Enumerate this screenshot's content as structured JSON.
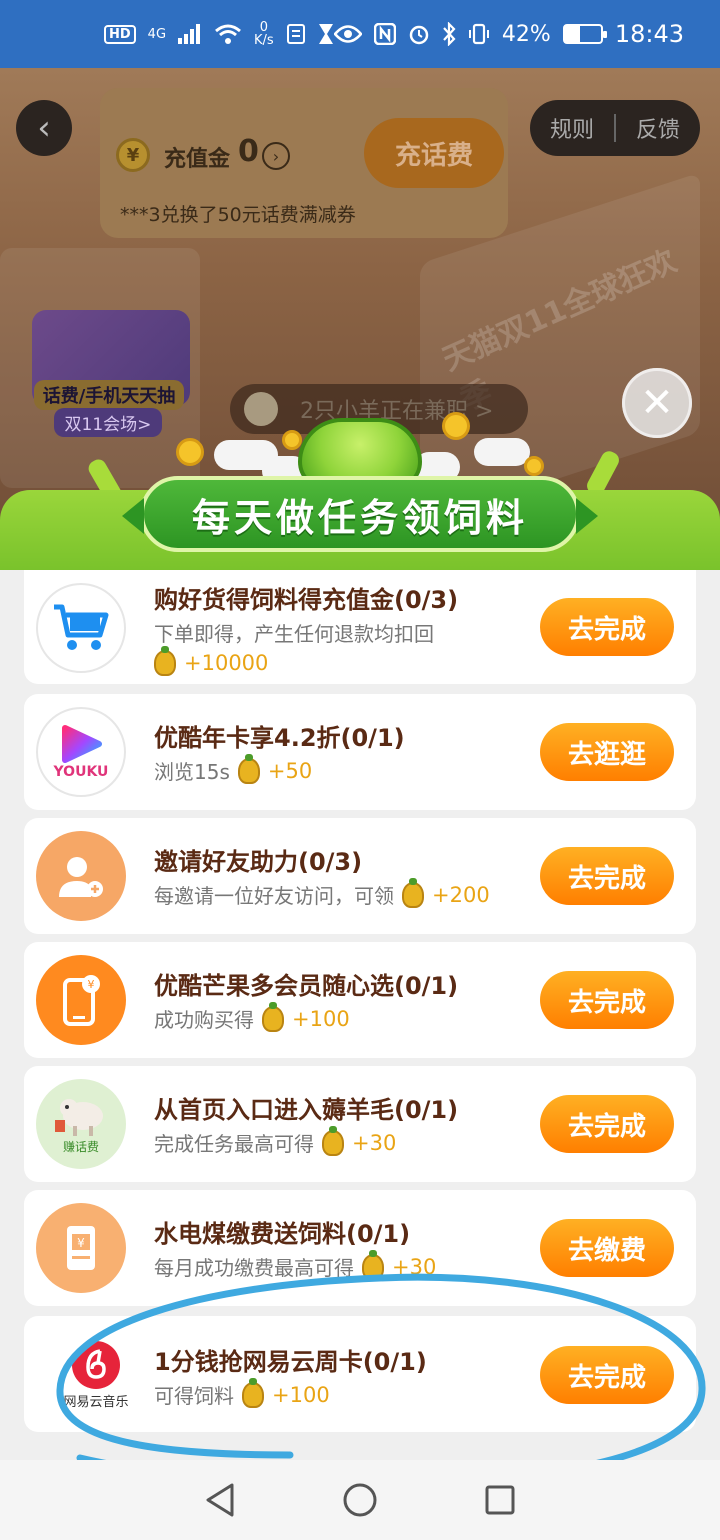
{
  "status_bar": {
    "hd": "HD",
    "net": "4G",
    "speed_value": "0",
    "speed_unit": "K/s",
    "battery": "42%",
    "battery_level": 0.42,
    "time": "18:43"
  },
  "background": {
    "recharge_label": "充值金",
    "recharge_value": "0",
    "recharge_button": "充话费",
    "ticker": "***3兑换了50元话费满减券",
    "rules": "规则",
    "feedback": "反馈",
    "promo_title": "话费/手机天天抽",
    "promo_sub": "双11会场>",
    "sheep_notice": "2只小羊正在兼职 >",
    "slogan": "天猫双11全球狂欢季"
  },
  "modal": {
    "title": "每天做任务领饲料"
  },
  "tasks": [
    {
      "title": "购好货得饲料得充值金(0/3)",
      "desc": "下单即得，产生任何退款均扣回",
      "reward": "+10000",
      "button": "去完成",
      "icon": "shopping-cart-icon"
    },
    {
      "title": "优酷年卡享4.2折(0/1)",
      "desc": "浏览15s",
      "reward": "+50",
      "button": "去逛逛",
      "icon": "youku-logo-icon",
      "icon_text": "YOUKU"
    },
    {
      "title": "邀请好友助力(0/3)",
      "desc": "每邀请一位好友访问，可领",
      "reward": "+200",
      "button": "去完成",
      "icon": "add-friend-icon"
    },
    {
      "title": "优酷芒果多会员随心选(0/1)",
      "desc": "成功购买得",
      "reward": "+100",
      "button": "去完成",
      "icon": "phone-payment-icon"
    },
    {
      "title": "从首页入口进入薅羊毛(0/1)",
      "desc": "完成任务最高可得",
      "reward": "+30",
      "button": "去完成",
      "icon": "sheep-icon",
      "icon_text": "赚话费"
    },
    {
      "title": "水电煤缴费送饲料(0/1)",
      "desc": "每月成功缴费最高可得",
      "reward": "+30",
      "button": "去缴费",
      "icon": "bill-icon"
    },
    {
      "title": "1分钱抢网易云周卡(0/1)",
      "desc": "可得饲料",
      "reward": "+100",
      "button": "去完成",
      "icon": "netease-music-icon",
      "icon_text": "网易云音乐"
    }
  ],
  "colors": {
    "status_bar": "#2f6fc1",
    "accent_orange": "#ff7f00",
    "title_brown": "#5a2a14",
    "reward_gold": "#e9a415",
    "ribbon_green": "#2d9523",
    "annotation_blue": "#3fa9e0"
  }
}
